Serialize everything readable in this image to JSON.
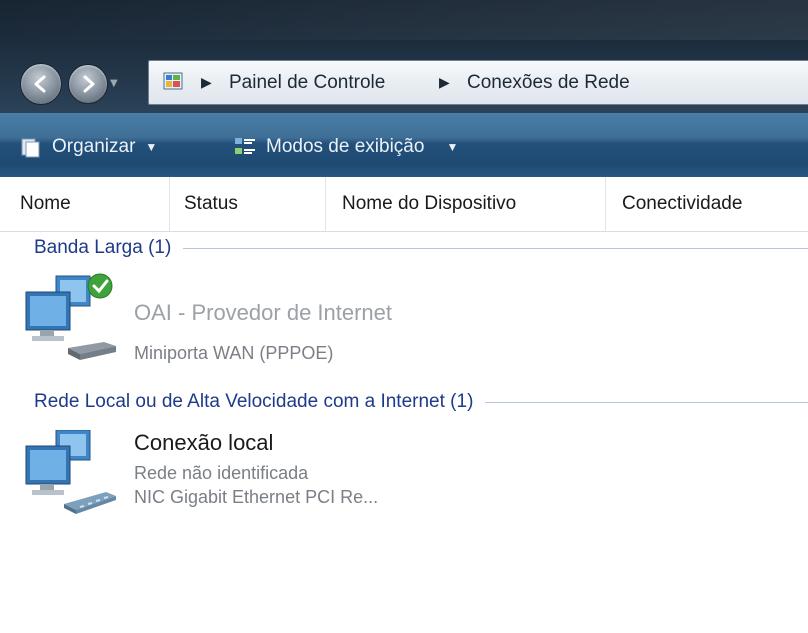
{
  "address_bar": {
    "breadcrumbs": [
      "Painel de Controle",
      "Conexões de Rede"
    ]
  },
  "command_bar": {
    "organize_label": "Organizar",
    "views_label": "Modos de exibição"
  },
  "columns": [
    "Nome",
    "Status",
    "Nome do Dispositivo",
    "Conectividade"
  ],
  "groups": [
    {
      "title": "Banda Larga (1)",
      "items": [
        {
          "name": "OAI - Provedor de Internet",
          "lines": [
            "Miniporta WAN (PPPOE)"
          ],
          "state": "disconnected",
          "badge": "connected-check-icon"
        }
      ]
    },
    {
      "title": "Rede Local ou de Alta Velocidade com a Internet (1)",
      "items": [
        {
          "name": "Conexão local",
          "lines": [
            "Rede não identificada",
            "NIC Gigabit Ethernet PCI Re..."
          ],
          "state": "connected"
        }
      ]
    }
  ],
  "colors": {
    "group_title": "#1e3a8a",
    "command_bar": "#23507a",
    "subtext": "#7a7f86"
  }
}
